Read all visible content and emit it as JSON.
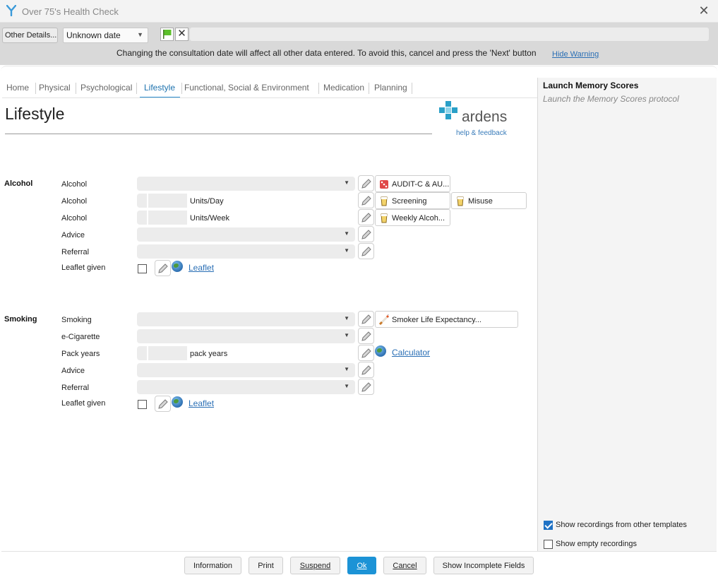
{
  "window": {
    "title": "Over 75's Health Check"
  },
  "toolbar": {
    "other_details_label": "Other Details...",
    "date_value": "Unknown date",
    "warning_text": "Changing the consultation date will affect all other data entered. To avoid this, cancel and press the 'Next' button",
    "hide_warning_label": "Hide Warning"
  },
  "tabs": [
    "Home",
    "Physical",
    "Psychological",
    "Lifestyle",
    "Functional, Social & Environment",
    "Medication",
    "Planning"
  ],
  "active_tab": "Lifestyle",
  "page": {
    "title": "Lifestyle",
    "logo_brand": "ardens",
    "logo_help": "help & feedback"
  },
  "alcohol": {
    "section": "Alcohol",
    "rows": {
      "alcohol1": "Alcohol",
      "alcohol2": "Alcohol",
      "alcohol2_unit": "Units/Day",
      "alcohol3": "Alcohol",
      "alcohol3_unit": "Units/Week",
      "advice": "Advice",
      "referral": "Referral",
      "leaflet": "Leaflet given",
      "leaflet_link": "Leaflet"
    },
    "chips": {
      "audit": "AUDIT-C & AU...",
      "screening": "Screening",
      "misuse": "Misuse",
      "weekly": "Weekly Alcoh..."
    }
  },
  "smoking": {
    "section": "Smoking",
    "rows": {
      "smoking": "Smoking",
      "ecig": "e-Cigarette",
      "pack_years": "Pack years",
      "pack_years_unit": "pack years",
      "advice": "Advice",
      "referral": "Referral",
      "leaflet": "Leaflet given",
      "leaflet_link": "Leaflet",
      "calculator_link": "Calculator"
    },
    "chips": {
      "life_expectancy": "Smoker Life Expectancy..."
    }
  },
  "sidebar": {
    "memory_title": "Launch Memory Scores",
    "memory_subtitle": "Launch the Memory Scores protocol",
    "show_other_templates": "Show recordings from other templates",
    "show_other_templates_checked": true,
    "show_empty": "Show empty recordings",
    "show_empty_checked": false
  },
  "footer": {
    "information": "Information",
    "print": "Print",
    "suspend": "Suspend",
    "ok": "Ok",
    "cancel": "Cancel",
    "show_incomplete": "Show Incomplete Fields"
  },
  "colors": {
    "accent": "#1c93d6",
    "link": "#2a6fb5",
    "tab_active": "#1d72ae"
  }
}
